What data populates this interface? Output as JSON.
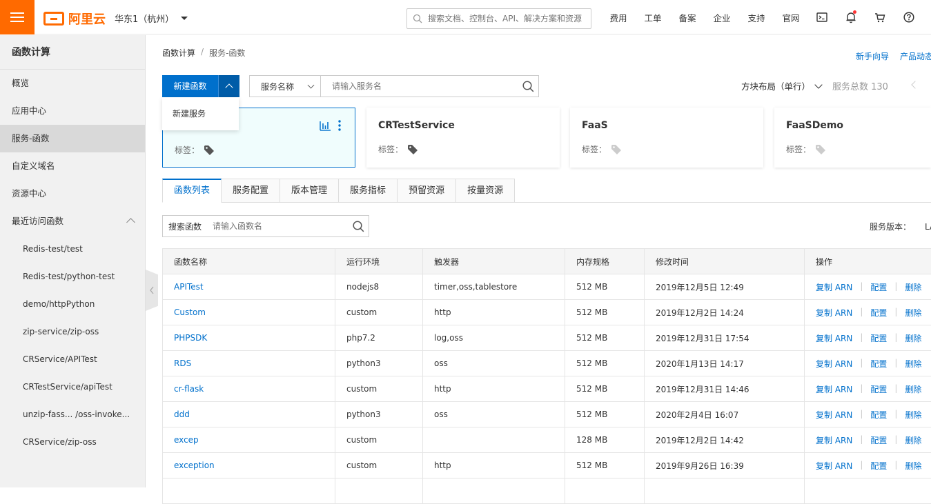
{
  "header": {
    "brand": "阿里云",
    "region": "华东1（杭州）",
    "search_placeholder": "搜索文档、控制台、API、解决方案和资源",
    "nav": [
      "费用",
      "工单",
      "备案",
      "企业",
      "支持",
      "官网"
    ]
  },
  "sidebar": {
    "title": "函数计算",
    "items": [
      "概览",
      "应用中心",
      "服务-函数",
      "自定义域名",
      "资源中心",
      "最近访问函数"
    ],
    "recent": [
      "Redis-test/test",
      "Redis-test/python-test",
      "demo/httpPython",
      "zip-service/zip-oss",
      "CRService/APITest",
      "CRTestService/apiTest",
      "unzip-fass... /oss-invoke...",
      "CRService/zip-oss"
    ]
  },
  "breadcrumb": {
    "root": "函数计算",
    "sep": "/",
    "current": "服务-函数"
  },
  "links": {
    "guide": "新手向导",
    "news": "产品动态"
  },
  "toolbar": {
    "new_function": "新建函数",
    "dropdown_item": "新建服务",
    "service_select": "服务名称",
    "service_placeholder": "请输入服务名",
    "layout": "方块布局（单行）",
    "total": "服务总数 130"
  },
  "cards": [
    {
      "name": "",
      "tag_label": "标签："
    },
    {
      "name": "CRTestService",
      "tag_label": "标签："
    },
    {
      "name": "FaaS",
      "tag_label": "标签："
    },
    {
      "name": "FaaSDemo",
      "tag_label": "标签："
    }
  ],
  "tabs": [
    "函数列表",
    "服务配置",
    "版本管理",
    "服务指标",
    "预留资源",
    "按量资源"
  ],
  "function_search": {
    "label": "搜索函数",
    "placeholder": "请输入函数名"
  },
  "service_version": {
    "label": "服务版本：",
    "value": "LA"
  },
  "table": {
    "columns": [
      "函数名称",
      "运行环境",
      "触发器",
      "内存规格",
      "修改时间",
      "操作"
    ],
    "actions": {
      "copy": "复制 ARN",
      "config": "配置",
      "delete": "删除",
      "sep": "|"
    },
    "rows": [
      {
        "name": "APITest",
        "runtime": "nodejs8",
        "trigger": "timer,oss,tablestore",
        "memory": "512 MB",
        "modified": "2019年12月5日 12:49"
      },
      {
        "name": "Custom",
        "runtime": "custom",
        "trigger": "http",
        "memory": "512 MB",
        "modified": "2019年12月2日 14:24"
      },
      {
        "name": "PHPSDK",
        "runtime": "php7.2",
        "trigger": "log,oss",
        "memory": "512 MB",
        "modified": "2019年12月31日 17:54"
      },
      {
        "name": "RDS",
        "runtime": "python3",
        "trigger": "oss",
        "memory": "512 MB",
        "modified": "2020年1月13日 14:17"
      },
      {
        "name": "cr-flask",
        "runtime": "custom",
        "trigger": "http",
        "memory": "512 MB",
        "modified": "2019年12月31日 14:46"
      },
      {
        "name": "ddd",
        "runtime": "python3",
        "trigger": "oss",
        "memory": "512 MB",
        "modified": "2020年2月4日 16:07"
      },
      {
        "name": "excep",
        "runtime": "custom",
        "trigger": "",
        "memory": "128 MB",
        "modified": "2019年12月2日 14:42"
      },
      {
        "name": "exception",
        "runtime": "custom",
        "trigger": "http",
        "memory": "512 MB",
        "modified": "2019年9月26日 16:39"
      },
      {
        "name": "",
        "runtime": "",
        "trigger": "",
        "memory": "",
        "modified": ""
      }
    ]
  },
  "colors": {
    "brand": "#ff6a00",
    "primary": "#0070cc"
  }
}
